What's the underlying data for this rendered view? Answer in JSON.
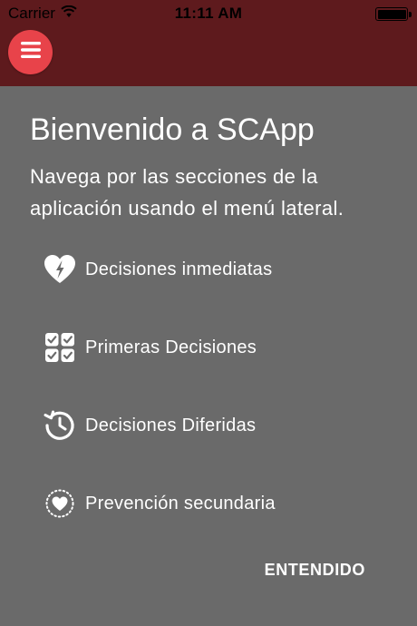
{
  "status_bar": {
    "carrier": "Carrier",
    "time": "11:11 AM",
    "wifi_icon": "wifi-icon",
    "battery_icon": "battery-icon"
  },
  "app_bar": {
    "color": "#5e1a1d",
    "menu_button_color": "#e8434a",
    "menu_icon": "hamburger-menu-icon"
  },
  "welcome": {
    "title": "Bienvenido a SCApp",
    "description": "Navega por las secciones de la aplicación usando el menú lateral.",
    "sections": [
      {
        "label": "Decisiones inmediatas",
        "icon": "heart-bolt-icon"
      },
      {
        "label": "Primeras Decisiones",
        "icon": "checklist-grid-icon"
      },
      {
        "label": "Decisiones Diferidas",
        "icon": "clock-history-icon"
      },
      {
        "label": "Prevención secundaria",
        "icon": "heart-circle-dotted-icon"
      }
    ],
    "confirm_label": "ENTENDIDO"
  },
  "overlay_color": "#6a6a6a"
}
